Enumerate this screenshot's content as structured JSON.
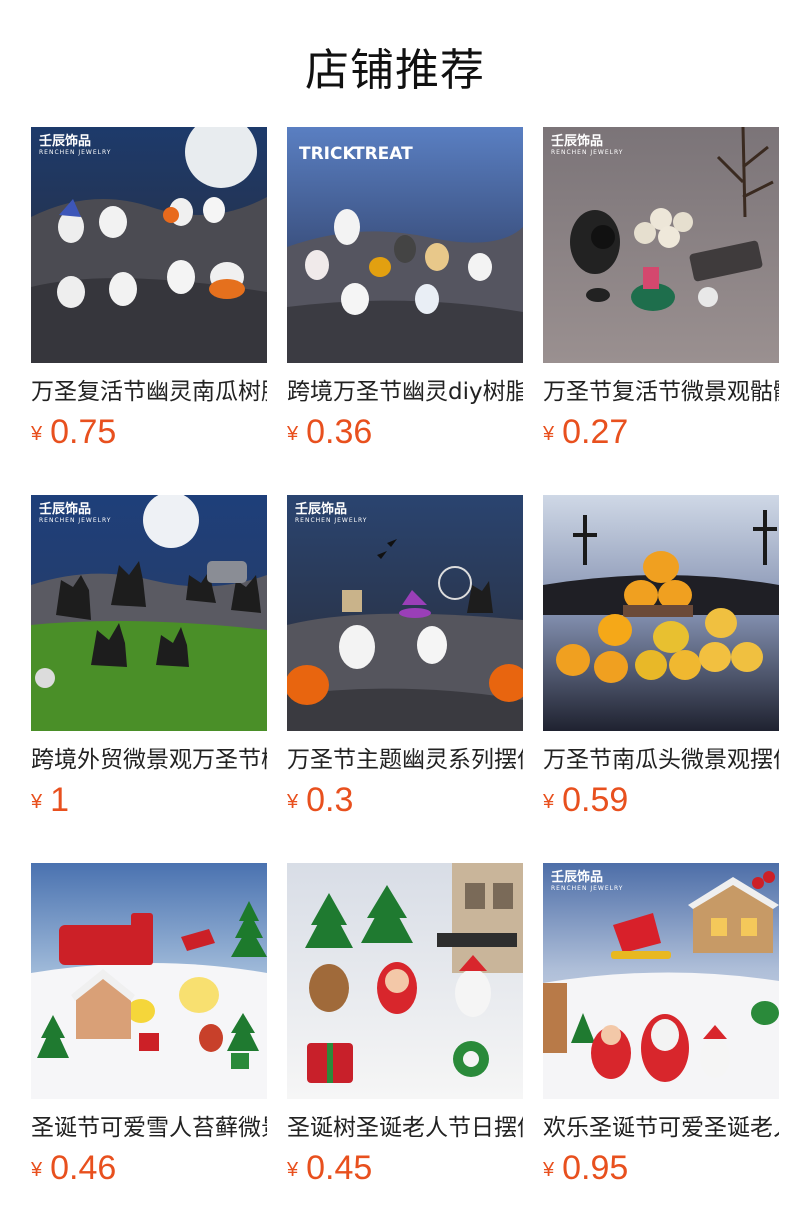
{
  "page_title": "店铺推荐",
  "brand": {
    "cn": "壬辰饰品",
    "en": "RENCHEN JEWELRY"
  },
  "colors": {
    "price": "#e8501e",
    "title": "#111111"
  },
  "products": [
    {
      "name": "万圣复活节幽灵南瓜树脂摆件",
      "currency": "¥",
      "price": "0.75",
      "scene": "halloween-ghosts",
      "brand_mark": "壬辰饰品"
    },
    {
      "name": "跨境万圣节幽灵diy树脂配件",
      "currency": "¥",
      "price": "0.36",
      "scene": "trick-or-treat",
      "brand_mark": "TRICK OR TREAT"
    },
    {
      "name": "万圣节复活节微景观骷髅摆件",
      "currency": "¥",
      "price": "0.27",
      "scene": "skull-pile",
      "brand_mark": "壬辰饰品"
    },
    {
      "name": "跨境外贸微景观万圣节树妖",
      "currency": "¥",
      "price": "1",
      "scene": "tree-monsters",
      "brand_mark": "壬辰饰品"
    },
    {
      "name": "万圣节主题幽灵系列摆件",
      "currency": "¥",
      "price": "0.3",
      "scene": "ghost-pumpkin",
      "brand_mark": "壬辰饰品"
    },
    {
      "name": "万圣节南瓜头微景观摆件",
      "currency": "¥",
      "price": "0.59",
      "scene": "pumpkin-tower",
      "brand_mark": ""
    },
    {
      "name": "圣诞节可爱雪人苔藓微景观",
      "currency": "¥",
      "price": "0.46",
      "scene": "christmas-snow-train",
      "brand_mark": ""
    },
    {
      "name": "圣诞树圣诞老人节日摆件",
      "currency": "¥",
      "price": "0.45",
      "scene": "christmas-figures",
      "brand_mark": ""
    },
    {
      "name": "欢乐圣诞节可爱圣诞老人",
      "currency": "¥",
      "price": "0.95",
      "scene": "christmas-sleigh",
      "brand_mark": "壬辰饰品"
    }
  ]
}
